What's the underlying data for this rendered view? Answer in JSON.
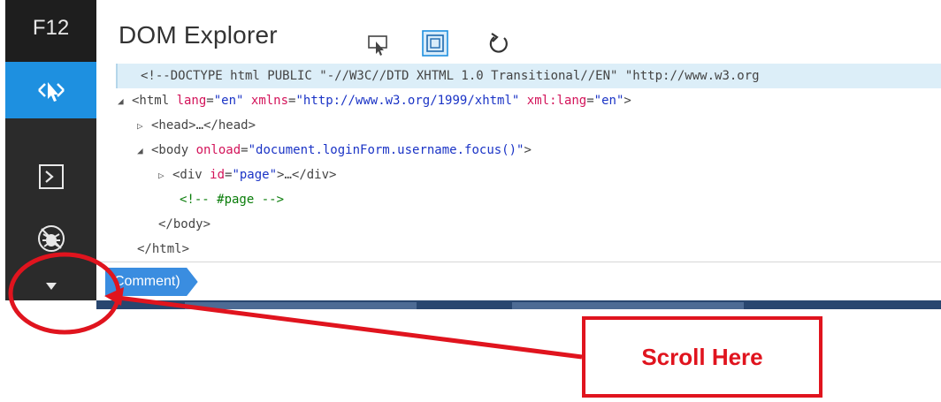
{
  "rail": {
    "label": "F12",
    "tools": [
      {
        "icon": "select-element-icon",
        "active": true
      },
      {
        "icon": "console-icon",
        "active": false
      },
      {
        "icon": "debugger-icon",
        "active": false
      }
    ],
    "more_icon": "chevron-down-icon"
  },
  "panel": {
    "title": "DOM Explorer",
    "toolbar_icons": [
      "select-element-icon",
      "highlight-icon",
      "refresh-icon"
    ]
  },
  "tree": [
    {
      "indent": 0,
      "twisty": "",
      "parts": [
        {
          "c": "cmt2",
          "t": "<!--DOCTYPE html PUBLIC \"-//W3C//DTD XHTML 1.0 Transitional//EN\" \"http://www.w3.org"
        }
      ],
      "selected": true
    },
    {
      "indent": 0,
      "twisty": "◢",
      "parts": [
        {
          "c": "tag",
          "t": "<html "
        },
        {
          "c": "attr",
          "t": "lang"
        },
        {
          "c": "tag",
          "t": "="
        },
        {
          "c": "val",
          "t": "\"en\""
        },
        {
          "c": "tag",
          "t": " "
        },
        {
          "c": "attr",
          "t": "xmlns"
        },
        {
          "c": "tag",
          "t": "="
        },
        {
          "c": "val",
          "t": "\"http://www.w3.org/1999/xhtml\""
        },
        {
          "c": "tag",
          "t": " "
        },
        {
          "c": "attr",
          "t": "xml:lang"
        },
        {
          "c": "tag",
          "t": "="
        },
        {
          "c": "val",
          "t": "\"en\""
        },
        {
          "c": "tag",
          "t": ">"
        }
      ]
    },
    {
      "indent": 1,
      "twisty": "▷",
      "parts": [
        {
          "c": "tag",
          "t": "<head>…</head>"
        }
      ]
    },
    {
      "indent": 1,
      "twisty": "◢",
      "parts": [
        {
          "c": "tag",
          "t": "<body "
        },
        {
          "c": "attr",
          "t": "onload"
        },
        {
          "c": "tag",
          "t": "="
        },
        {
          "c": "val",
          "t": "\"document.loginForm.username.focus()\""
        },
        {
          "c": "tag",
          "t": ">"
        }
      ]
    },
    {
      "indent": 2,
      "twisty": "▷",
      "parts": [
        {
          "c": "tag",
          "t": "<div "
        },
        {
          "c": "attr",
          "t": "id"
        },
        {
          "c": "tag",
          "t": "="
        },
        {
          "c": "val",
          "t": "\"page\""
        },
        {
          "c": "tag",
          "t": ">…</div>"
        }
      ]
    },
    {
      "indent": 3,
      "twisty": "",
      "parts": [
        {
          "c": "cmt",
          "t": "<!-- #page -->"
        }
      ]
    },
    {
      "indent": 2,
      "twisty": "",
      "parts": [
        {
          "c": "tag",
          "t": "</body>"
        }
      ]
    },
    {
      "indent": 1,
      "twisty": "",
      "parts": [
        {
          "c": "tag",
          "t": "</html>"
        }
      ]
    }
  ],
  "breadcrumb": {
    "label": "Comment)"
  },
  "annotation": {
    "callout_text": "Scroll Here",
    "color": "#e0141e"
  }
}
